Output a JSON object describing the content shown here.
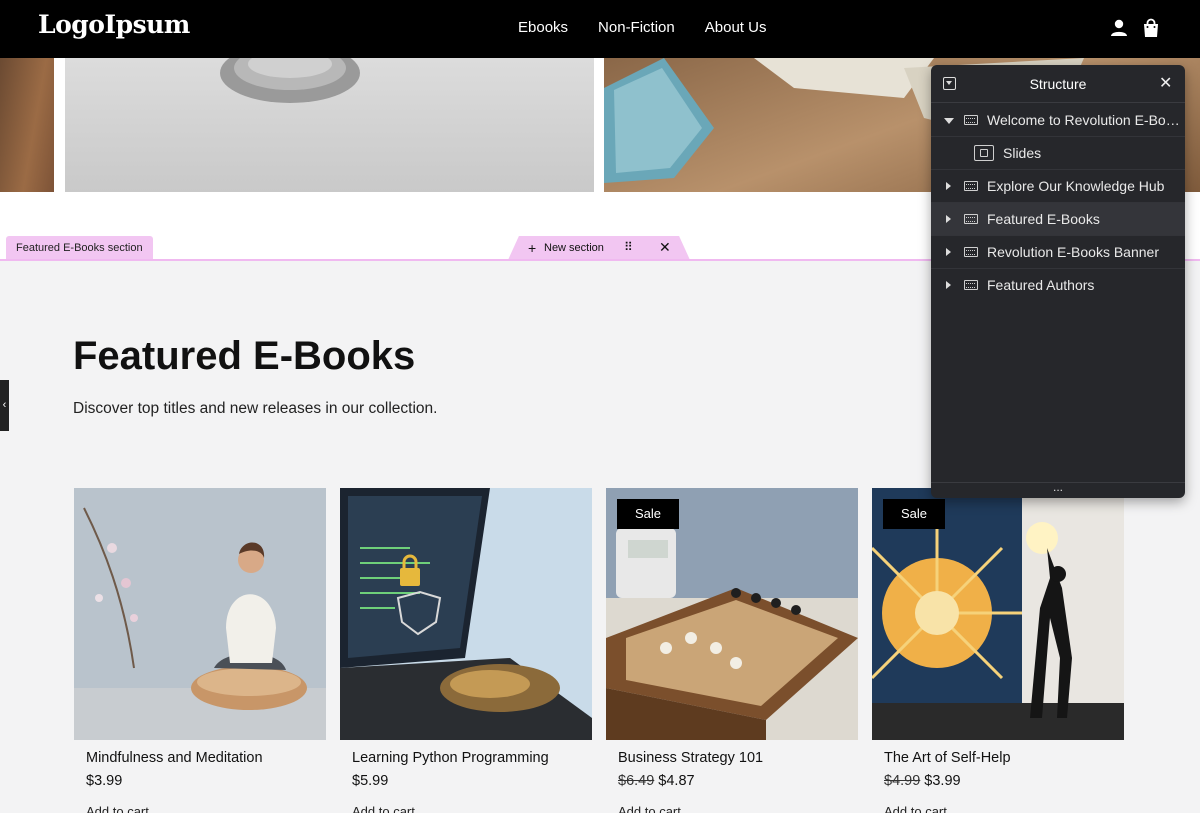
{
  "header": {
    "logo": "LogoIpsum",
    "nav": [
      "Ebooks",
      "Non-Fiction",
      "About Us"
    ],
    "icons": [
      "user-icon",
      "shopping-bag-icon"
    ]
  },
  "editor": {
    "section_label": "Featured E-Books section",
    "new_section_plus": "+",
    "new_section_label": "New section",
    "drag_icon": "⠿",
    "close_icon": "✕"
  },
  "featured": {
    "title": "Featured E-Books",
    "subtitle": "Discover top titles and new releases in our collection.",
    "side_tab": "‹",
    "products": [
      {
        "name": "Mindfulness and Meditation",
        "price": "$3.99",
        "old_price": "",
        "sale": "",
        "cart": "Add to cart"
      },
      {
        "name": "Learning Python Programming",
        "price": "$5.99",
        "old_price": "",
        "sale": "",
        "cart": "Add to cart"
      },
      {
        "name": "Business Strategy 101",
        "price": "$4.87",
        "old_price": "$6.49",
        "sale": "Sale",
        "cart": "Add to cart"
      },
      {
        "name": "The Art of Self-Help",
        "price": "$3.99",
        "old_price": "$4.99",
        "sale": "Sale",
        "cart": "Add to cart"
      }
    ]
  },
  "structure_panel": {
    "title": "Structure",
    "close": "✕",
    "footer": "...",
    "items": [
      {
        "label": "Welcome to Revolution E-Books"
      },
      {
        "label": "Slides"
      },
      {
        "label": "Explore Our Knowledge Hub"
      },
      {
        "label": "Featured E-Books"
      },
      {
        "label": "Revolution E-Books Banner"
      },
      {
        "label": "Featured Authors"
      }
    ]
  },
  "colors": {
    "header_bg": "#000000",
    "editor_accent": "#f2c6f2",
    "panel_bg": "#26272b",
    "section_bg": "#f3f3f4"
  }
}
